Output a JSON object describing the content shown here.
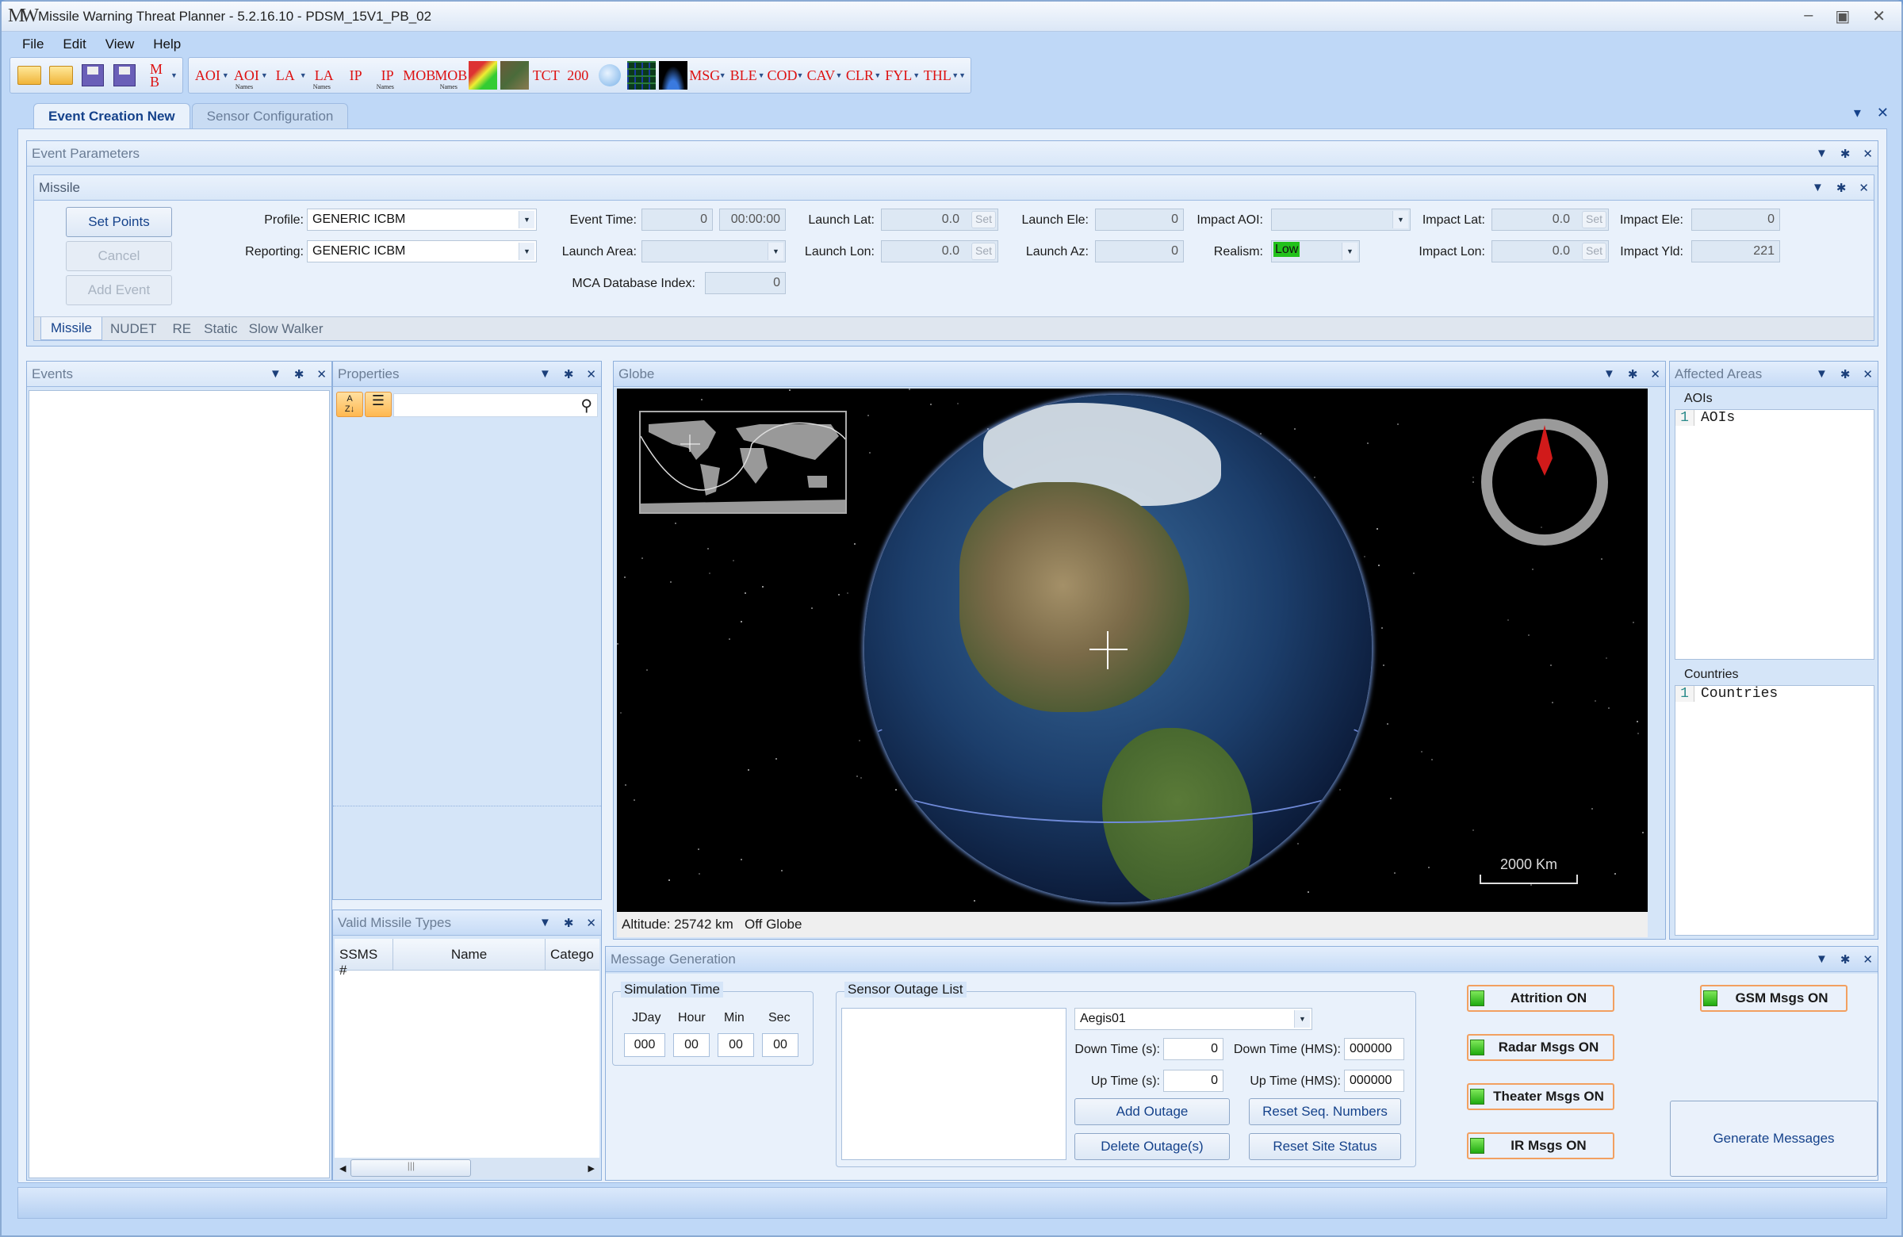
{
  "window": {
    "title": "Missile Warning Threat Planner - 5.2.16.10 - PDSM_15V1_PB_02",
    "logo": "MW"
  },
  "menu": [
    "File",
    "Edit",
    "View",
    "Help"
  ],
  "toolbar": {
    "file_icons": [
      "open-folder-icon",
      "new-folder-icon",
      "save-icon",
      "save-as-icon",
      "add-mob-icon"
    ],
    "layer_icons": [
      {
        "name": "aoi-icon",
        "text": "AOI",
        "sub": ""
      },
      {
        "name": "aoi-names-icon",
        "text": "AOI",
        "sub": "Names"
      },
      {
        "name": "la-icon",
        "text": "LA",
        "sub": ""
      },
      {
        "name": "la-names-icon",
        "text": "LA",
        "sub": "Names"
      },
      {
        "name": "ip-icon",
        "text": "IP",
        "sub": ""
      },
      {
        "name": "ip-names-icon",
        "text": "IP",
        "sub": "Names"
      },
      {
        "name": "mob-icon",
        "text": "MOB",
        "sub": ""
      },
      {
        "name": "mob-names-icon",
        "text": "MOB",
        "sub": "Names"
      },
      {
        "name": "tct-icon",
        "text": "TCT",
        "sub": ""
      },
      {
        "name": "two-hundred-icon",
        "text": "200",
        "sub": ""
      },
      {
        "name": "msg-icon",
        "text": "MSG",
        "sub": ""
      },
      {
        "name": "ble-icon",
        "text": "BLE",
        "sub": ""
      },
      {
        "name": "cod-icon",
        "text": "COD",
        "sub": ""
      },
      {
        "name": "cav-icon",
        "text": "CAV",
        "sub": ""
      },
      {
        "name": "clr-icon",
        "text": "CLR",
        "sub": ""
      },
      {
        "name": "fyl-icon",
        "text": "FYL",
        "sub": ""
      },
      {
        "name": "thl-icon",
        "text": "THL",
        "sub": ""
      }
    ]
  },
  "tabs": [
    {
      "label": "Event Creation New",
      "active": true
    },
    {
      "label": "Sensor Configuration",
      "active": false
    }
  ],
  "event_parameters": {
    "title": "Event Parameters",
    "missile": {
      "title": "Missile",
      "buttons": {
        "set_points": "Set Points",
        "cancel": "Cancel",
        "add_event": "Add Event"
      },
      "profile_label": "Profile:",
      "profile": "GENERIC ICBM",
      "reporting_label": "Reporting:",
      "reporting": "GENERIC ICBM",
      "event_time_label": "Event Time:",
      "event_time": "0",
      "event_time_hms": "00:00:00",
      "launch_area_label": "Launch Area:",
      "launch_area": "",
      "mca_label": "MCA Database Index:",
      "mca": "0",
      "launch_lat_label": "Launch Lat:",
      "launch_lat": "0.0",
      "launch_lon_label": "Launch Lon:",
      "launch_lon": "0.0",
      "launch_ele_label": "Launch Ele:",
      "launch_ele": "0",
      "launch_az_label": "Launch Az:",
      "launch_az": "0",
      "impact_aoi_label": "Impact AOI:",
      "impact_aoi": "",
      "realism_label": "Realism:",
      "realism": "Low",
      "impact_lat_label": "Impact Lat:",
      "impact_lat": "0.0",
      "impact_lon_label": "Impact Lon:",
      "impact_lon": "0.0",
      "impact_ele_label": "Impact Ele:",
      "impact_ele": "0",
      "impact_yld_label": "Impact Yld:",
      "impact_yld": "221",
      "set_label": "Set"
    },
    "subtabs": [
      "Missile",
      "NUDET",
      "RE",
      "Static",
      "Slow Walker"
    ]
  },
  "events_panel": {
    "title": "Events"
  },
  "properties_panel": {
    "title": "Properties",
    "search_placeholder": ""
  },
  "valid_missile_types": {
    "title": "Valid Missile Types",
    "columns": [
      "SSMS #",
      "Name",
      "Catego"
    ]
  },
  "globe": {
    "title": "Globe",
    "scale": "2000 Km",
    "altitude": "Altitude: 25742 km",
    "position": "Off Globe"
  },
  "affected_areas": {
    "title": "Affected Areas",
    "aois_label": "AOIs",
    "aois_lines": [
      "AOIs"
    ],
    "countries_label": "Countries",
    "countries_lines": [
      "Countries"
    ]
  },
  "message_generation": {
    "title": "Message Generation",
    "sim_time": {
      "label": "Simulation Time",
      "headers": [
        "JDay",
        "Hour",
        "Min",
        "Sec"
      ],
      "values": [
        "000",
        "00",
        "00",
        "00"
      ]
    },
    "outage": {
      "label": "Sensor Outage List",
      "sensor": "Aegis01",
      "down_s_label": "Down Time (s):",
      "down_s": "0",
      "down_hms_label": "Down Time (HMS):",
      "down_hms": "000000",
      "up_s_label": "Up Time (s):",
      "up_s": "0",
      "up_hms_label": "Up Time (HMS):",
      "up_hms": "000000",
      "add": "Add Outage",
      "delete": "Delete Outage(s)",
      "reset_seq": "Reset Seq. Numbers",
      "reset_site": "Reset Site Status"
    },
    "toggles": [
      "Attrition ON",
      "Radar Msgs ON",
      "Theater Msgs ON",
      "IR Msgs ON",
      "GSM Msgs ON"
    ],
    "generate": "Generate Messages"
  },
  "colors": {
    "accent": "#15428b",
    "led_on": "#2fcf20",
    "realism_low": "#22c11a",
    "toggle_border": "#f2a060"
  }
}
